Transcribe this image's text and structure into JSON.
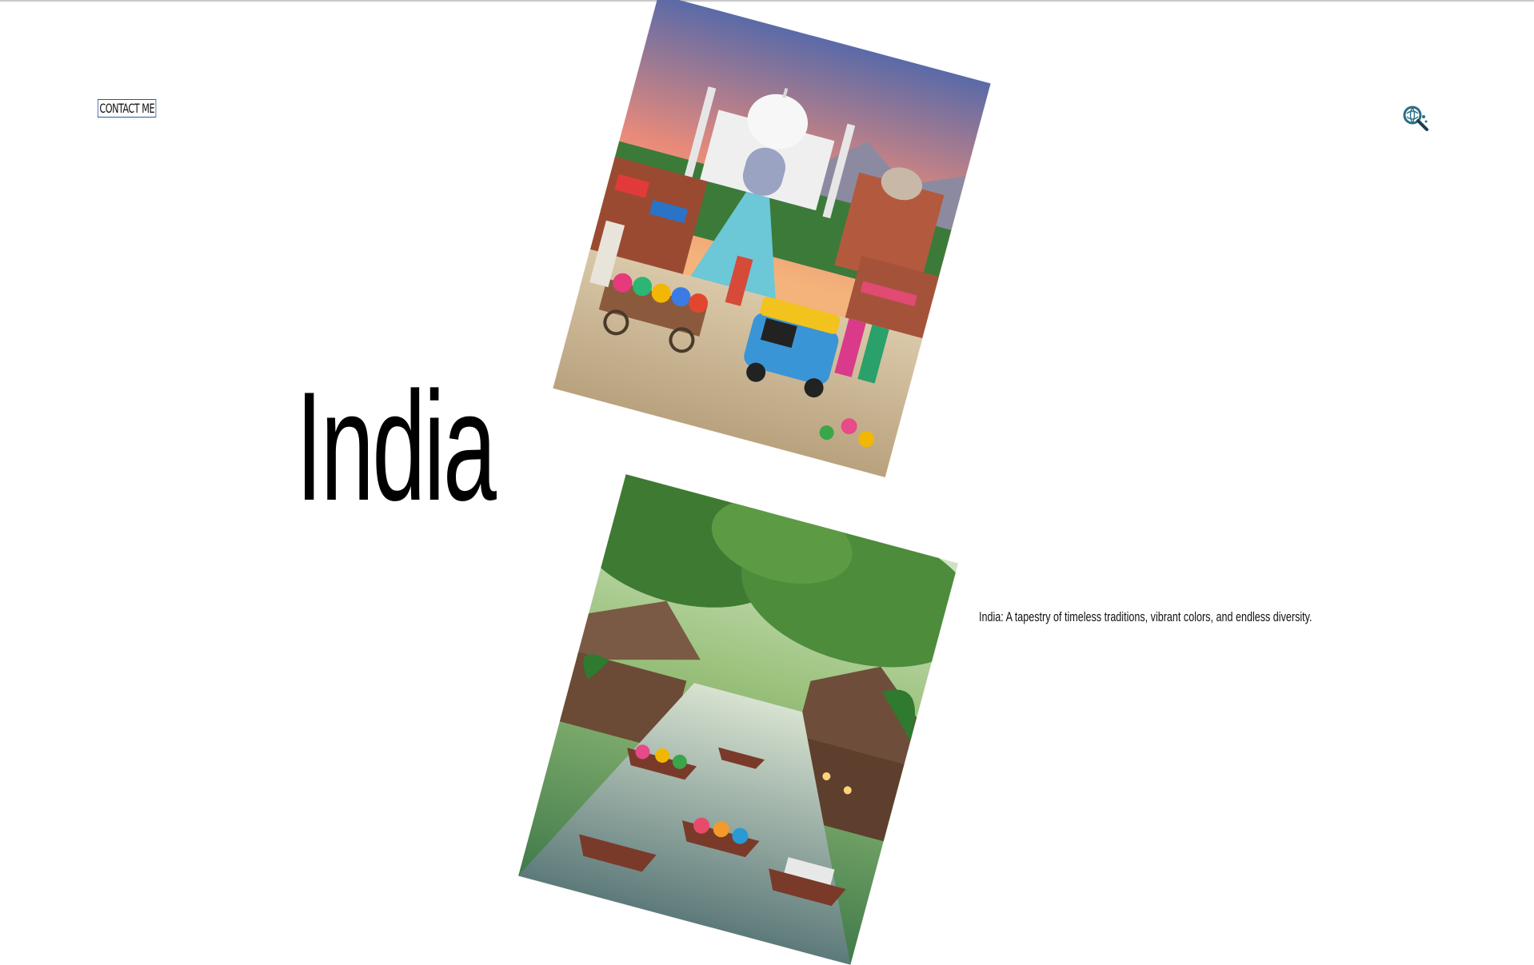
{
  "header": {
    "contact_label": "CONTACT ME",
    "logo_icon": "magnifier-globe-icon"
  },
  "hero": {
    "title": "India",
    "tagline": "India: A tapestry of timeless traditions, vibrant colors, and endless diversity."
  },
  "gallery": {
    "images": [
      {
        "icon": "taj-mahal-street-market-illustration"
      },
      {
        "icon": "floating-market-river-illustration"
      }
    ]
  },
  "colors": {
    "text": "#000000",
    "contact_border": "#1f5aa8",
    "logo_accent": "#2a6f86",
    "background": "#ffffff"
  }
}
